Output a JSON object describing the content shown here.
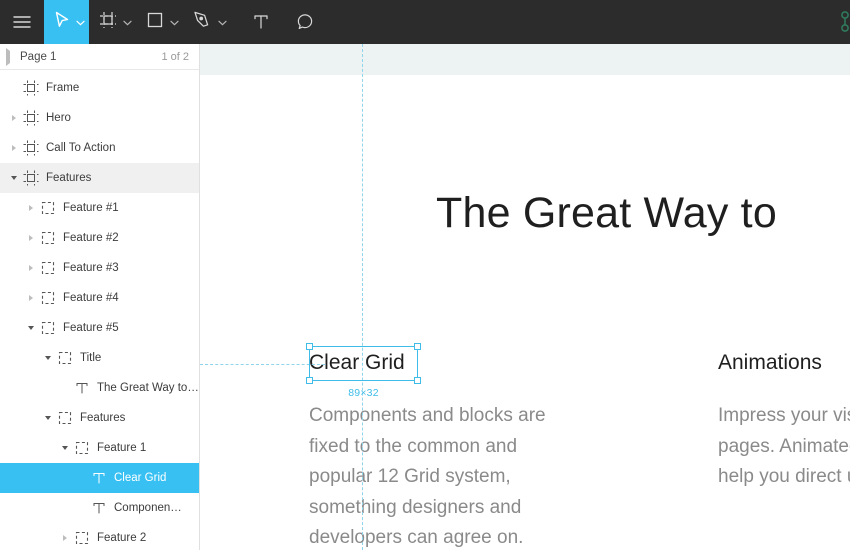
{
  "toolbar": {
    "menu_label": "Menu",
    "tools": [
      {
        "name": "menu-button",
        "icon": "hamburger-icon",
        "label": "Menu",
        "active": false,
        "has_dropdown": false
      },
      {
        "name": "move-tool",
        "icon": "cursor-icon",
        "label": "Move",
        "active": true,
        "has_dropdown": true
      },
      {
        "name": "frame-tool",
        "icon": "frame-icon",
        "label": "Frame",
        "active": false,
        "has_dropdown": true
      },
      {
        "name": "shape-tool",
        "icon": "rectangle-icon",
        "label": "Rectangle",
        "active": false,
        "has_dropdown": true
      },
      {
        "name": "pen-tool",
        "icon": "pen-icon",
        "label": "Pen",
        "active": false,
        "has_dropdown": true
      },
      {
        "name": "text-tool",
        "icon": "text-icon",
        "label": "Text",
        "active": false,
        "has_dropdown": false
      },
      {
        "name": "comment-tool",
        "icon": "comment-icon",
        "label": "Comment",
        "active": false,
        "has_dropdown": false
      }
    ],
    "accent_color": "#38c0f3",
    "background_color": "#2c2c2c"
  },
  "sidebar": {
    "page": {
      "name": "Page 1",
      "count": "1 of 2"
    },
    "layers": [
      {
        "label": "Frame",
        "icon": "frame-icon",
        "depth": 0,
        "caret": "none",
        "state": "normal"
      },
      {
        "label": "Hero",
        "icon": "frame-icon",
        "depth": 0,
        "caret": "right",
        "state": "normal"
      },
      {
        "label": "Call To Action",
        "icon": "frame-icon",
        "depth": 0,
        "caret": "right",
        "state": "normal"
      },
      {
        "label": "Features",
        "icon": "frame-icon",
        "depth": 0,
        "caret": "down",
        "state": "hovered"
      },
      {
        "label": "Feature #1",
        "icon": "group-icon",
        "depth": 1,
        "caret": "right",
        "state": "normal"
      },
      {
        "label": "Feature #2",
        "icon": "group-icon",
        "depth": 1,
        "caret": "right",
        "state": "normal"
      },
      {
        "label": "Feature #3",
        "icon": "group-icon",
        "depth": 1,
        "caret": "right",
        "state": "normal"
      },
      {
        "label": "Feature #4",
        "icon": "group-icon",
        "depth": 1,
        "caret": "right",
        "state": "normal"
      },
      {
        "label": "Feature #5",
        "icon": "group-icon",
        "depth": 1,
        "caret": "down",
        "state": "normal"
      },
      {
        "label": "Title",
        "icon": "group-icon",
        "depth": 2,
        "caret": "down",
        "state": "normal"
      },
      {
        "label": "The Great Way to …",
        "icon": "text-icon",
        "depth": 3,
        "caret": "none",
        "state": "normal"
      },
      {
        "label": "Features",
        "icon": "group-icon",
        "depth": 2,
        "caret": "down",
        "state": "normal"
      },
      {
        "label": "Feature 1",
        "icon": "group-icon",
        "depth": 3,
        "caret": "down",
        "state": "normal"
      },
      {
        "label": "Clear Grid",
        "icon": "text-icon",
        "depth": 4,
        "caret": "none",
        "state": "selected"
      },
      {
        "label": "Componen…",
        "icon": "text-icon",
        "depth": 4,
        "caret": "none",
        "state": "normal"
      },
      {
        "label": "Feature 2",
        "icon": "group-icon",
        "depth": 3,
        "caret": "right",
        "state": "normal"
      }
    ],
    "selected_color": "#38c0f3"
  },
  "canvas": {
    "artboard_title": "The Great Way to",
    "columns": [
      {
        "heading": "Clear Grid",
        "body": "Components and blocks are fixed to the common and popular 12 Grid system, something designers and developers can agree on."
      },
      {
        "heading": "Animations",
        "body": "Impress your visitors with your pages. Animated indicators can help you direct users' attention."
      }
    ],
    "selection": {
      "dimensions": "89×32",
      "accent_color": "#3fbde8"
    },
    "guides": {
      "color": "#8fd4ea"
    }
  }
}
